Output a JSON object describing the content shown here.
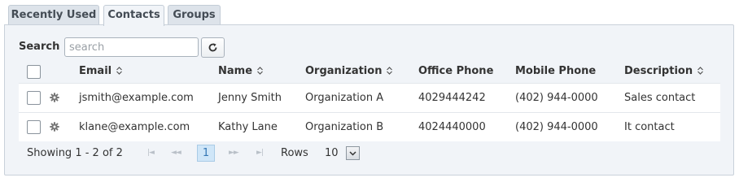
{
  "tabs": [
    {
      "label": "Recently Used",
      "active": false
    },
    {
      "label": "Contacts",
      "active": true
    },
    {
      "label": "Groups",
      "active": false
    }
  ],
  "search": {
    "label": "Search",
    "placeholder": "search",
    "value": ""
  },
  "columns": [
    {
      "label": "Email",
      "sortable": true
    },
    {
      "label": "Name",
      "sortable": true
    },
    {
      "label": "Organization",
      "sortable": true
    },
    {
      "label": "Office Phone",
      "sortable": false
    },
    {
      "label": "Mobile Phone",
      "sortable": false
    },
    {
      "label": "Description",
      "sortable": true
    }
  ],
  "rows": [
    {
      "email": "jsmith@example.com",
      "name": "Jenny Smith",
      "organization": "Organization A",
      "office_phone": "4029444242",
      "mobile_phone": "(402) 944-0000",
      "description": "Sales contact"
    },
    {
      "email": "klane@example.com",
      "name": "Kathy Lane",
      "organization": "Organization B",
      "office_phone": "4024440000",
      "mobile_phone": "(402) 944-0000",
      "description": "It contact"
    }
  ],
  "pager": {
    "showing_text": "Showing 1 - 2 of 2",
    "current_page": "1",
    "rows_label": "Rows",
    "rows_per_page": "10"
  },
  "icons": {
    "refresh": "refresh-icon",
    "sort": "sort-arrows-icon",
    "row_action": "gear-icon",
    "first": "first-page-icon",
    "prev": "prev-page-icon",
    "next": "next-page-icon",
    "last": "last-page-icon",
    "dropdown": "chevron-down-icon"
  },
  "colors": {
    "panel_bg": "#f1f4f8",
    "tab_bg": "#dde3ea",
    "current_page_bg": "#cfe6f8",
    "current_page_text": "#3577b5"
  }
}
